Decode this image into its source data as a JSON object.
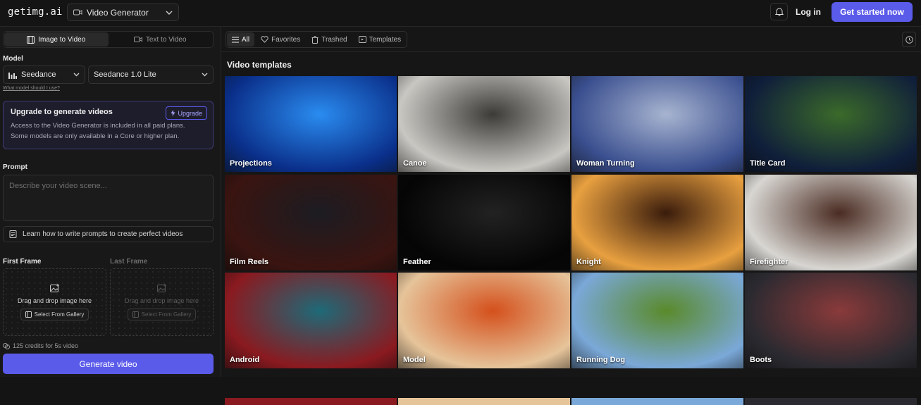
{
  "header": {
    "logo": "getimg.ai",
    "tool_select": "Video Generator",
    "login": "Log in",
    "get_started": "Get started now"
  },
  "sidebar": {
    "tabs": [
      {
        "label": "Image to Video",
        "active": true,
        "icon": "film-icon"
      },
      {
        "label": "Text to Video",
        "active": false,
        "icon": "video-camera-icon"
      }
    ],
    "model_label": "Model",
    "model_provider": "Seedance",
    "model_version": "Seedance 1.0 Lite",
    "model_help": "What model should I use?",
    "upgrade": {
      "title": "Upgrade to generate videos",
      "button": "Upgrade",
      "desc_line1": "Access to the Video Generator is included in all paid plans.",
      "desc_line2": "Some models are only available in a Core or higher plan."
    },
    "prompt_label": "Prompt",
    "prompt_placeholder": "Describe your video scene...",
    "learn_link": "Learn how to write prompts to create perfect videos",
    "first_frame_label": "First Frame",
    "last_frame_label": "Last Frame",
    "drop_text": "Drag and drop image here",
    "gallery_button": "Select From Gallery",
    "credits": "125 credits for 5s video",
    "generate_button": "Generate video"
  },
  "main": {
    "filters": [
      {
        "label": "All",
        "active": true,
        "icon": "list-icon"
      },
      {
        "label": "Favorites",
        "active": false,
        "icon": "heart-icon"
      },
      {
        "label": "Trashed",
        "active": false,
        "icon": "trash-icon"
      },
      {
        "label": "Templates",
        "active": false,
        "icon": "template-icon"
      }
    ],
    "section_title": "Video templates",
    "templates": [
      {
        "name": "Projections",
        "c1": "#0a2f8a",
        "c2": "#2a8cf0"
      },
      {
        "name": "Canoe",
        "c1": "#c9c7c2",
        "c2": "#3c3b38"
      },
      {
        "name": "Woman Turning",
        "c1": "#3a4f8f",
        "c2": "#a7b4d0"
      },
      {
        "name": "Title Card",
        "c1": "#0f1e3a",
        "c2": "#3b6a2a"
      },
      {
        "name": "Film Reels",
        "c1": "#3a1410",
        "c2": "#1c1c22"
      },
      {
        "name": "Feather",
        "c1": "#050505",
        "c2": "#222222"
      },
      {
        "name": "Knight",
        "c1": "#e8a040",
        "c2": "#3a1c0c"
      },
      {
        "name": "Firefighter",
        "c1": "#d8d6d2",
        "c2": "#4a2c22"
      },
      {
        "name": "Android",
        "c1": "#8a1a20",
        "c2": "#1e6a78"
      },
      {
        "name": "Model",
        "c1": "#e6c49a",
        "c2": "#d4501c"
      },
      {
        "name": "Running Dog",
        "c1": "#7aa8d8",
        "c2": "#5a8a2a"
      },
      {
        "name": "Boots",
        "c1": "#2a2a30",
        "c2": "#8a3a3a"
      }
    ]
  }
}
